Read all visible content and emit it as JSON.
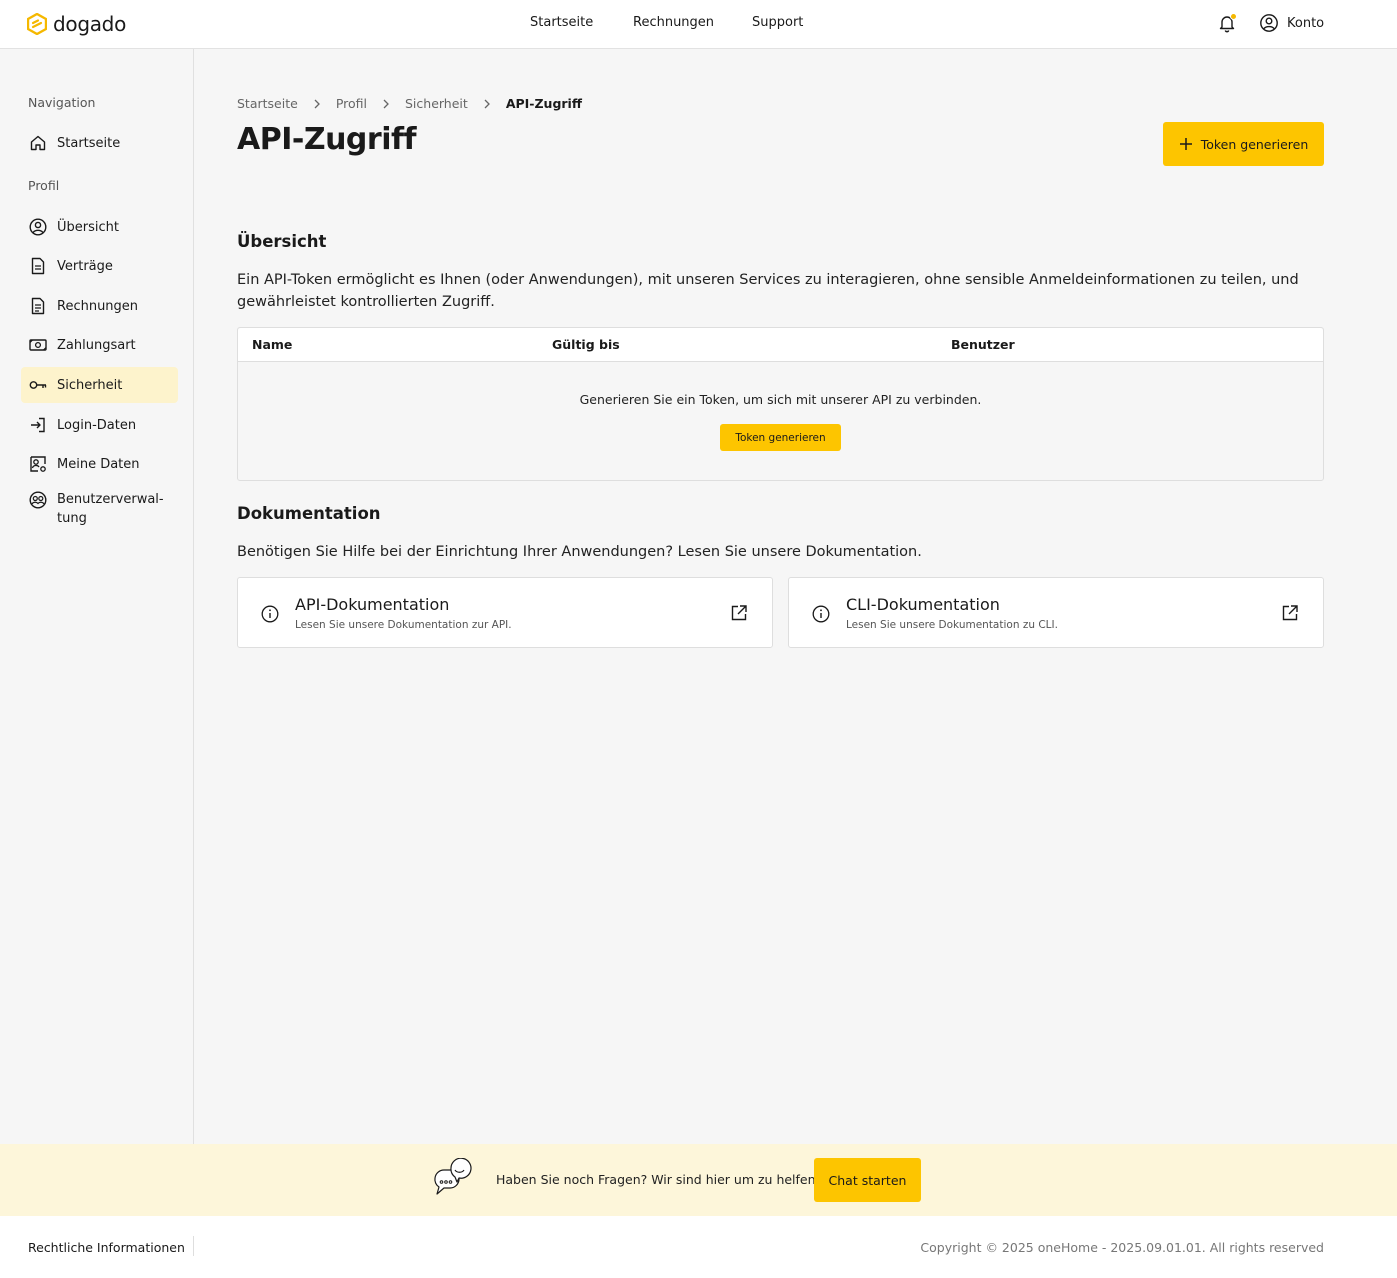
{
  "header": {
    "brand": "dogado",
    "nav": [
      "Startseite",
      "Rechnungen",
      "Support"
    ],
    "account_label": "Konto",
    "brand_color": "#f5b800"
  },
  "sidebar": {
    "heading_navigation": "Navigation",
    "home_label": "Startseite",
    "heading_profile": "Profil",
    "items": [
      {
        "label": "Übersicht",
        "icon": "user-circle-icon"
      },
      {
        "label": "Verträge",
        "icon": "document-icon"
      },
      {
        "label": "Rechnungen",
        "icon": "invoice-icon"
      },
      {
        "label": "Zahlungsart",
        "icon": "money-icon"
      },
      {
        "label": "Sicherheit",
        "icon": "key-icon",
        "active": true
      },
      {
        "label": "Login-Daten",
        "icon": "login-icon"
      },
      {
        "label": "Meine Daten",
        "icon": "user-settings-icon"
      },
      {
        "label": "Benutzerverwal-\ntung",
        "icon": "users-icon"
      }
    ]
  },
  "breadcrumb": [
    "Startseite",
    "Profil",
    "Sicherheit",
    "API-Zugriff"
  ],
  "page": {
    "title": "API-Zugriff",
    "generate_button": "Token generieren"
  },
  "overview": {
    "title": "Übersicht",
    "text": "Ein API-Token ermöglicht es Ihnen (oder Anwendungen), mit unseren Services zu interagieren, ohne sensible Anmeldeinformationen zu teilen, und gewährleistet kontrollierten Zugriff.",
    "table": {
      "columns": [
        "Name",
        "Gültig bis",
        "Benutzer"
      ],
      "empty_text": "Generieren Sie ein Token, um sich mit unserer API zu verbinden.",
      "empty_button": "Token generieren"
    }
  },
  "documentation": {
    "title": "Dokumentation",
    "text": "Benötigen Sie Hilfe bei der Einrichtung Ihrer Anwendungen? Lesen Sie unsere Dokumentation.",
    "cards": [
      {
        "title": "API-Dokumentation",
        "subtitle": "Lesen Sie unsere Dokumentation zur API."
      },
      {
        "title": "CLI-Dokumentation",
        "subtitle": "Lesen Sie unsere Dokumentation zu CLI."
      }
    ]
  },
  "help": {
    "text": "Haben Sie noch Fragen? Wir sind hier um zu helfen.",
    "button": "Chat starten"
  },
  "footer": {
    "legal": "Rechtliche Informationen",
    "copyright": "Copyright © 2025 oneHome - 2025.09.01.01. All rights reserved"
  }
}
